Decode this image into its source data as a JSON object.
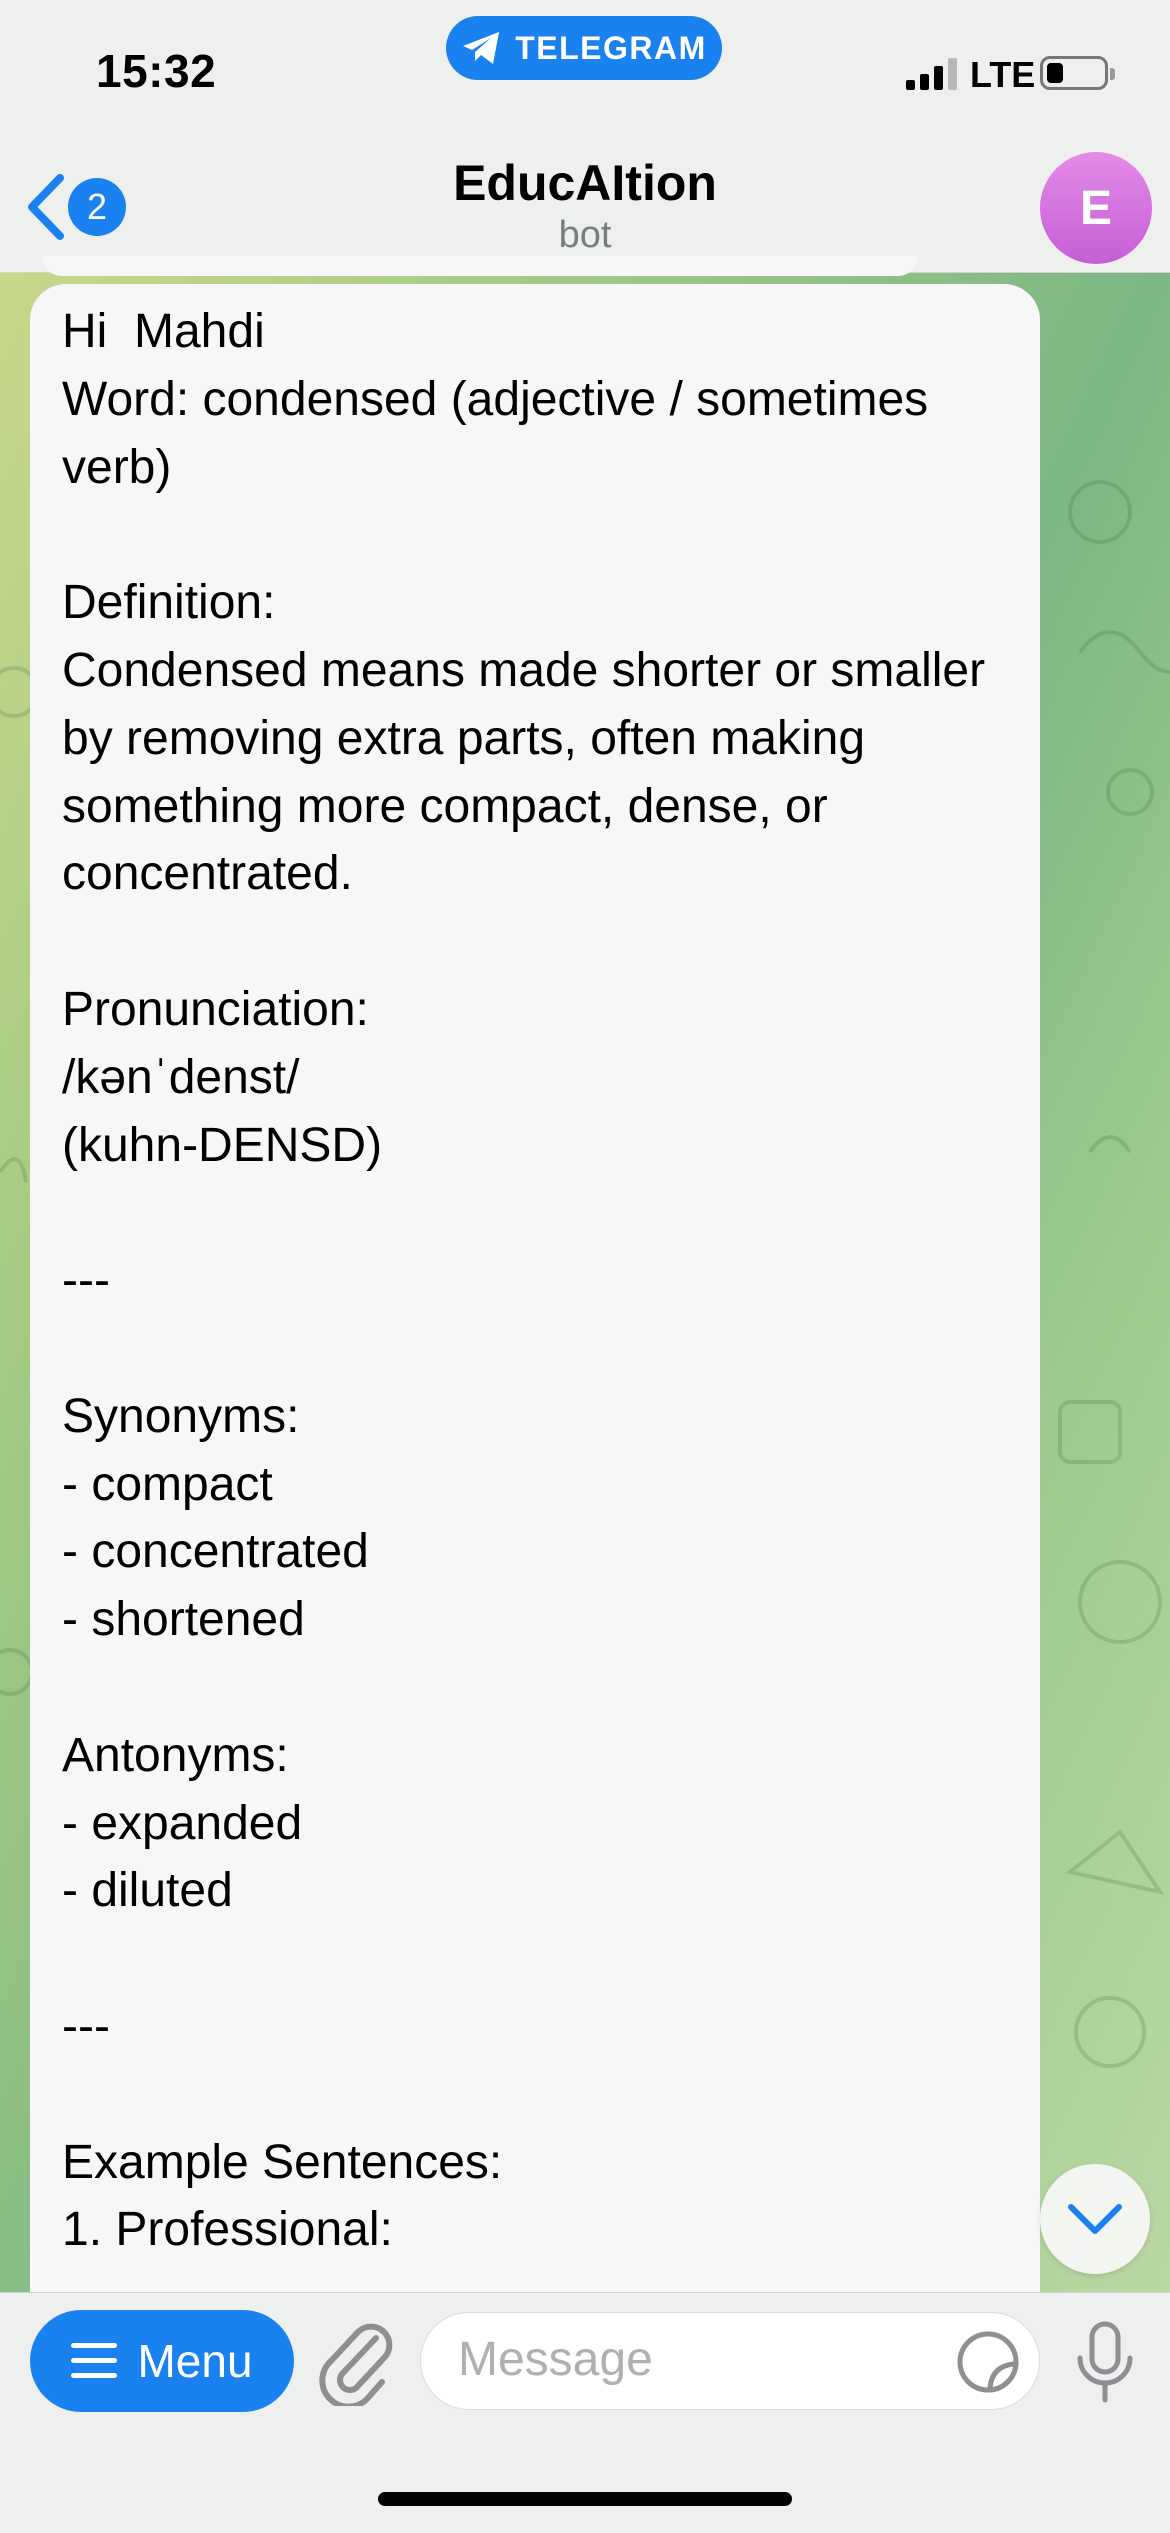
{
  "status_bar": {
    "time": "15:32",
    "app_pill": "TELEGRAM",
    "network": "LTE"
  },
  "header": {
    "back_count": "2",
    "title": "EducAItion",
    "subtitle": "bot",
    "avatar_letter": "E"
  },
  "message": {
    "text": "Hi  Mahdi\nWord: condensed (adjective / sometimes verb)\n\nDefinition:\nCondensed means made shorter or smaller by removing extra parts, often making something more compact, dense, or concentrated.\n\nPronunciation:\n/kənˈdenst/\n(kuhn-DENSD)\n\n---\n\nSynonyms:\n- compact\n- concentrated\n- shortened\n\nAntonyms:\n- expanded\n- diluted\n\n---\n\nExample Sentences:\n1. Professional:"
  },
  "input_bar": {
    "menu_label": "Menu",
    "placeholder": "Message"
  },
  "colors": {
    "accent": "#1a82f0",
    "avatar": "#d46fdc",
    "bubble": "#f7f7f7"
  },
  "icons": [
    "telegram-plane-icon",
    "back-chevron-icon",
    "scroll-down-chevron-icon",
    "hamburger-icon",
    "paperclip-icon",
    "sticker-icon",
    "microphone-icon"
  ]
}
